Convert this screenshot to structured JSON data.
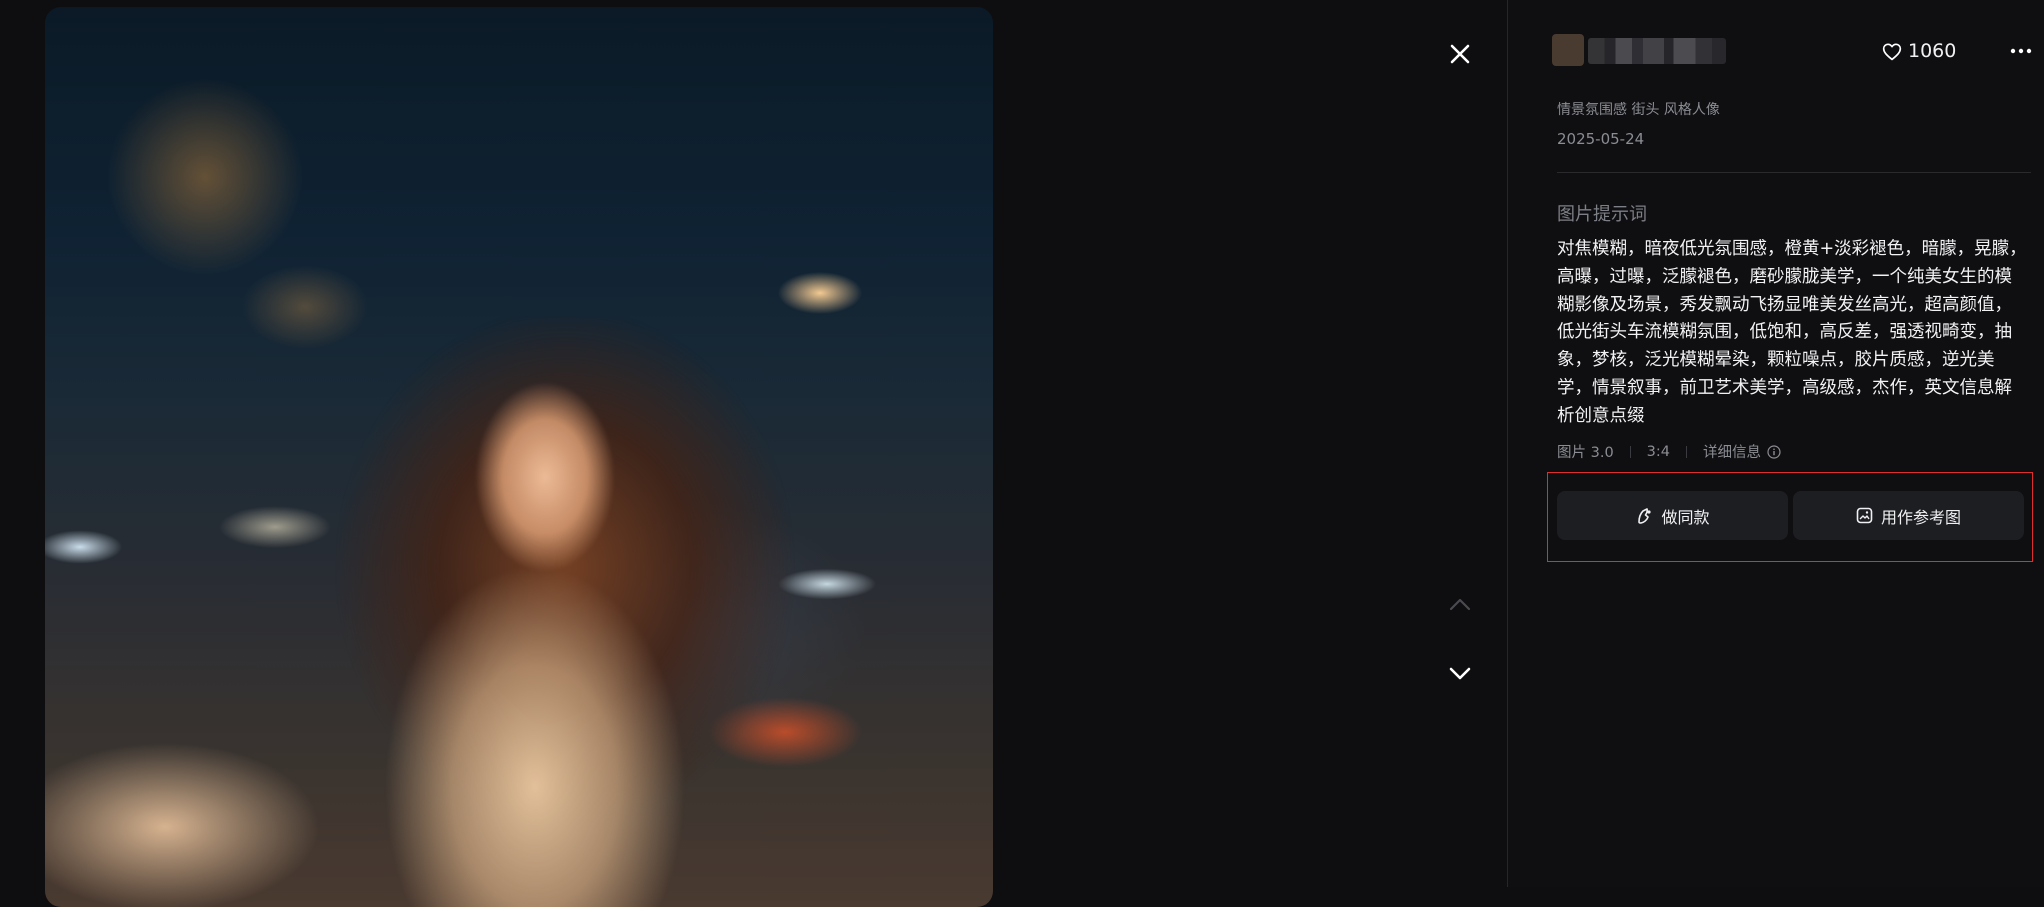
{
  "viewer": {
    "close_icon": "close-icon",
    "nav_up_icon": "chevron-up-icon",
    "nav_down_icon": "chevron-down-icon"
  },
  "panel": {
    "header": {
      "likes_count": "1060",
      "like_icon": "heart-icon",
      "more_icon": "more-horizontal-icon"
    },
    "tags": "情景氛围感 街头 风格人像",
    "date": "2025-05-24",
    "prompt_label": "图片提示词",
    "prompt_text": "对焦模糊，暗夜低光氛围感，橙黄+淡彩褪色，暗朦，晃朦，高曝，过曝，泛朦褪色，磨砂朦胧美学，一个纯美女生的模糊影像及场景，秀发飘动飞扬显唯美发丝高光，超高颜值，低光街头车流模糊氛围，低饱和，高反差，强透视畸变，抽象，梦核，泛光模糊晕染，颗粒噪点，胶片质感，逆光美学，情景叙事，前卫艺术美学，高级感，杰作，英文信息解析创意点缀",
    "meta": {
      "model": "图片 3.0",
      "ratio": "3:4",
      "details": "详细信息"
    },
    "actions": {
      "make_same": "做同款",
      "use_reference": "用作参考图"
    }
  },
  "colors": {
    "background": "#0e0e10",
    "panel_bg": "#0f0f11",
    "button_bg": "#1d1e22",
    "highlight": "#e02d2d"
  }
}
